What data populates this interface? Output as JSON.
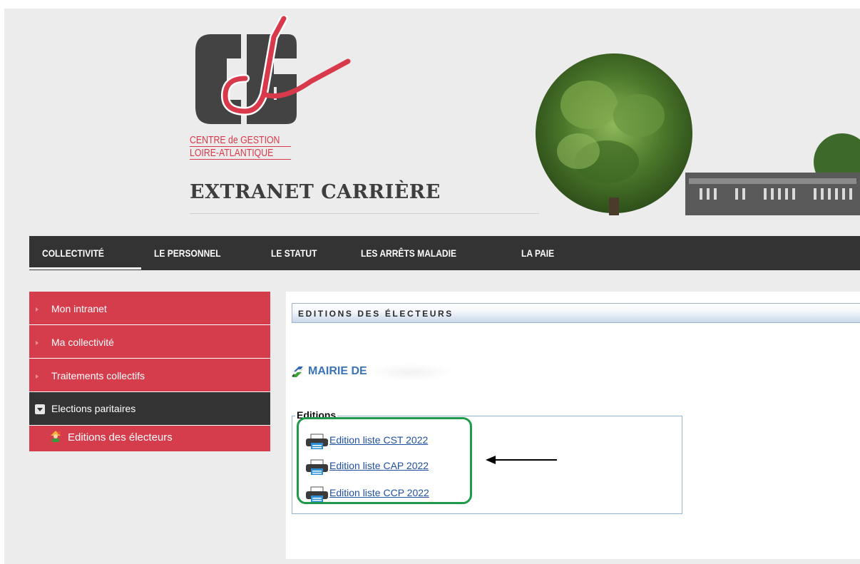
{
  "header": {
    "logo_line1": "CENTRE de GESTION",
    "logo_line2": "LOIRE-ATLANTIQUE",
    "site_title": "EXTRANET CARRIÈRE"
  },
  "nav": {
    "items": [
      {
        "label": "COLLECTIVITÉ",
        "active": true
      },
      {
        "label": "LE PERSONNEL",
        "active": false
      },
      {
        "label": "LE STATUT",
        "active": false
      },
      {
        "label": "LES ARRÊTS MALADIE",
        "active": false
      },
      {
        "label": "LA PAIE",
        "active": false
      }
    ]
  },
  "sidebar": {
    "items": [
      {
        "label": "Mon intranet"
      },
      {
        "label": "Ma collectivité"
      },
      {
        "label": "Traitements collectifs"
      },
      {
        "label": "Elections paritaires",
        "expanded": true
      }
    ],
    "subitems": [
      {
        "label": "Editions des électeurs"
      }
    ]
  },
  "main": {
    "section_title": "EDITIONS DES ÉLECTEURS",
    "mairie_label": "MAIRIE DE",
    "editions": {
      "legend": "Editions",
      "links": [
        {
          "label": "Edition liste CST 2022"
        },
        {
          "label": "Edition liste CAP 2022"
        },
        {
          "label": "Edition liste CCP 2022"
        }
      ]
    }
  },
  "colors": {
    "brand_red": "#d63d4c",
    "nav_dark": "#333333",
    "link_blue": "#2150a0",
    "highlight_green": "#1f9a4a"
  },
  "icons": {
    "logo": "cdg-logo",
    "edition_link": "printer-icon",
    "mairie": "mairie-flag-icon",
    "subitem": "voters-icon",
    "annotation": "arrow-left-icon"
  }
}
